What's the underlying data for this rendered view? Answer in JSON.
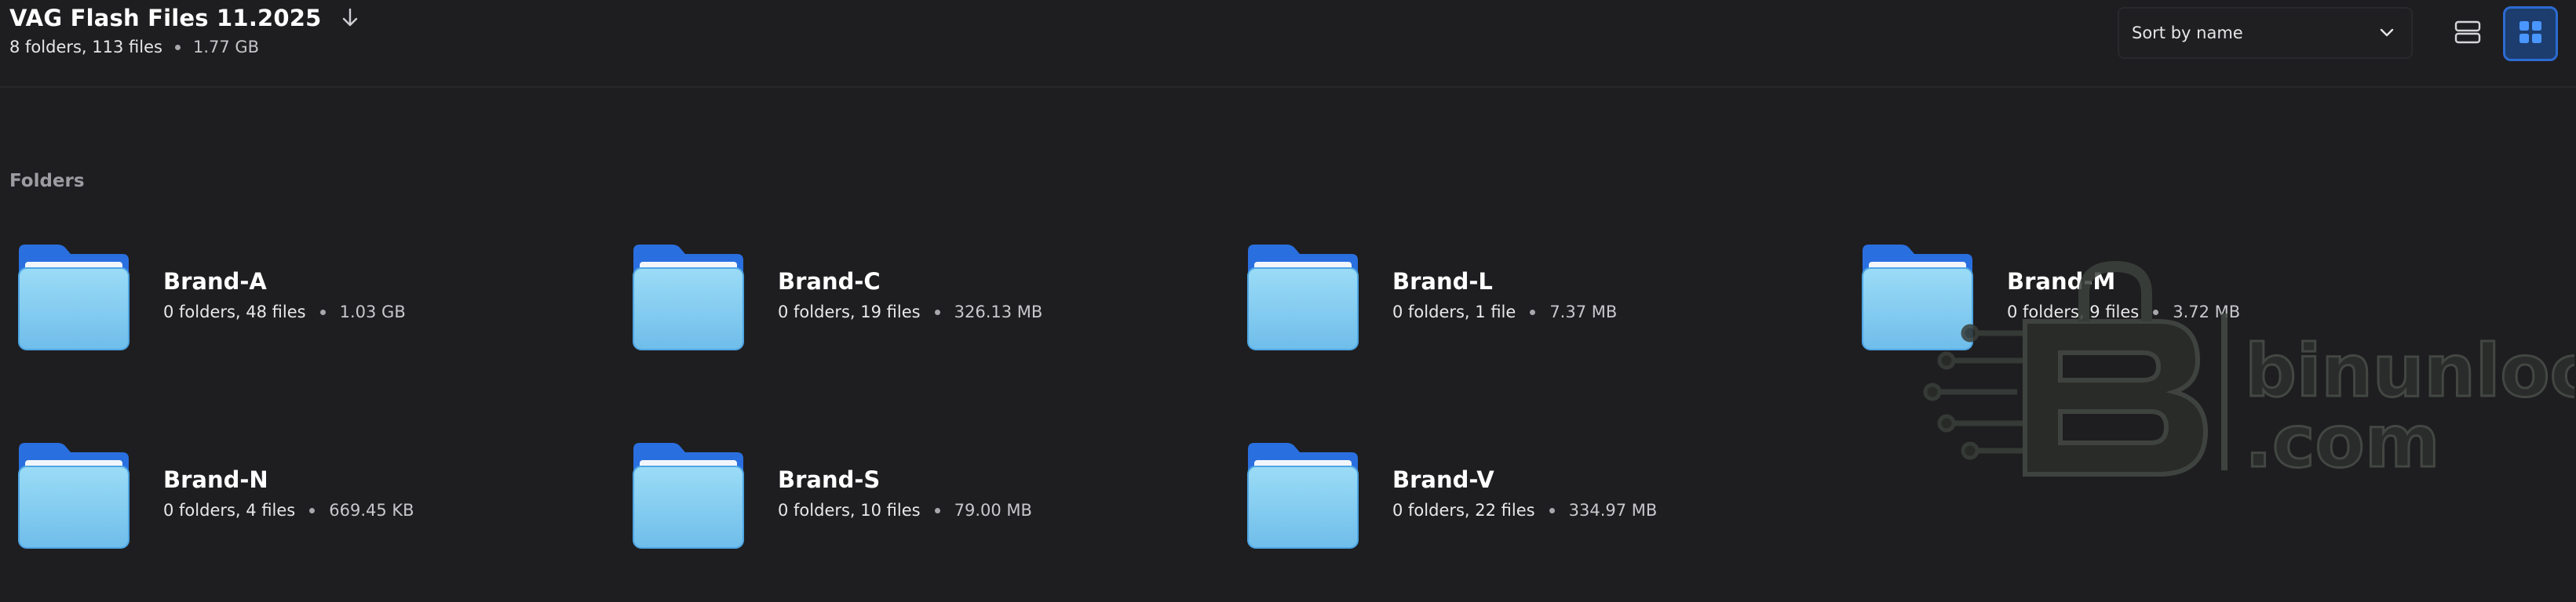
{
  "header": {
    "title": "VAG Flash Files 11.2025",
    "stats": "8 folders, 113 files",
    "total_size": "1.77 GB"
  },
  "toolbar": {
    "sort_label": "Sort by name",
    "active_view": "grid"
  },
  "section": {
    "label": "Folders"
  },
  "folders": [
    {
      "name": "Brand-A",
      "stats": "0 folders, 48 files",
      "size": "1.03 GB"
    },
    {
      "name": "Brand-C",
      "stats": "0 folders, 19 files",
      "size": "326.13 MB"
    },
    {
      "name": "Brand-L",
      "stats": "0 folders, 1 file",
      "size": "7.37 MB"
    },
    {
      "name": "Brand-M",
      "stats": "0 folders, 9 files",
      "size": "3.72 MB"
    },
    {
      "name": "Brand-N",
      "stats": "0 folders, 4 files",
      "size": "669.45 KB"
    },
    {
      "name": "Brand-S",
      "stats": "0 folders, 10 files",
      "size": "79.00 MB"
    },
    {
      "name": "Brand-V",
      "stats": "0 folders, 22 files",
      "size": "334.97 MB"
    }
  ],
  "watermark": {
    "line1": "binunlock",
    "line2": ".com"
  },
  "colors": {
    "background": "#1e1e20",
    "accent": "#2c6bd2",
    "folder_tab": "#2a6fe0",
    "folder_body": "#7cc8ef"
  }
}
